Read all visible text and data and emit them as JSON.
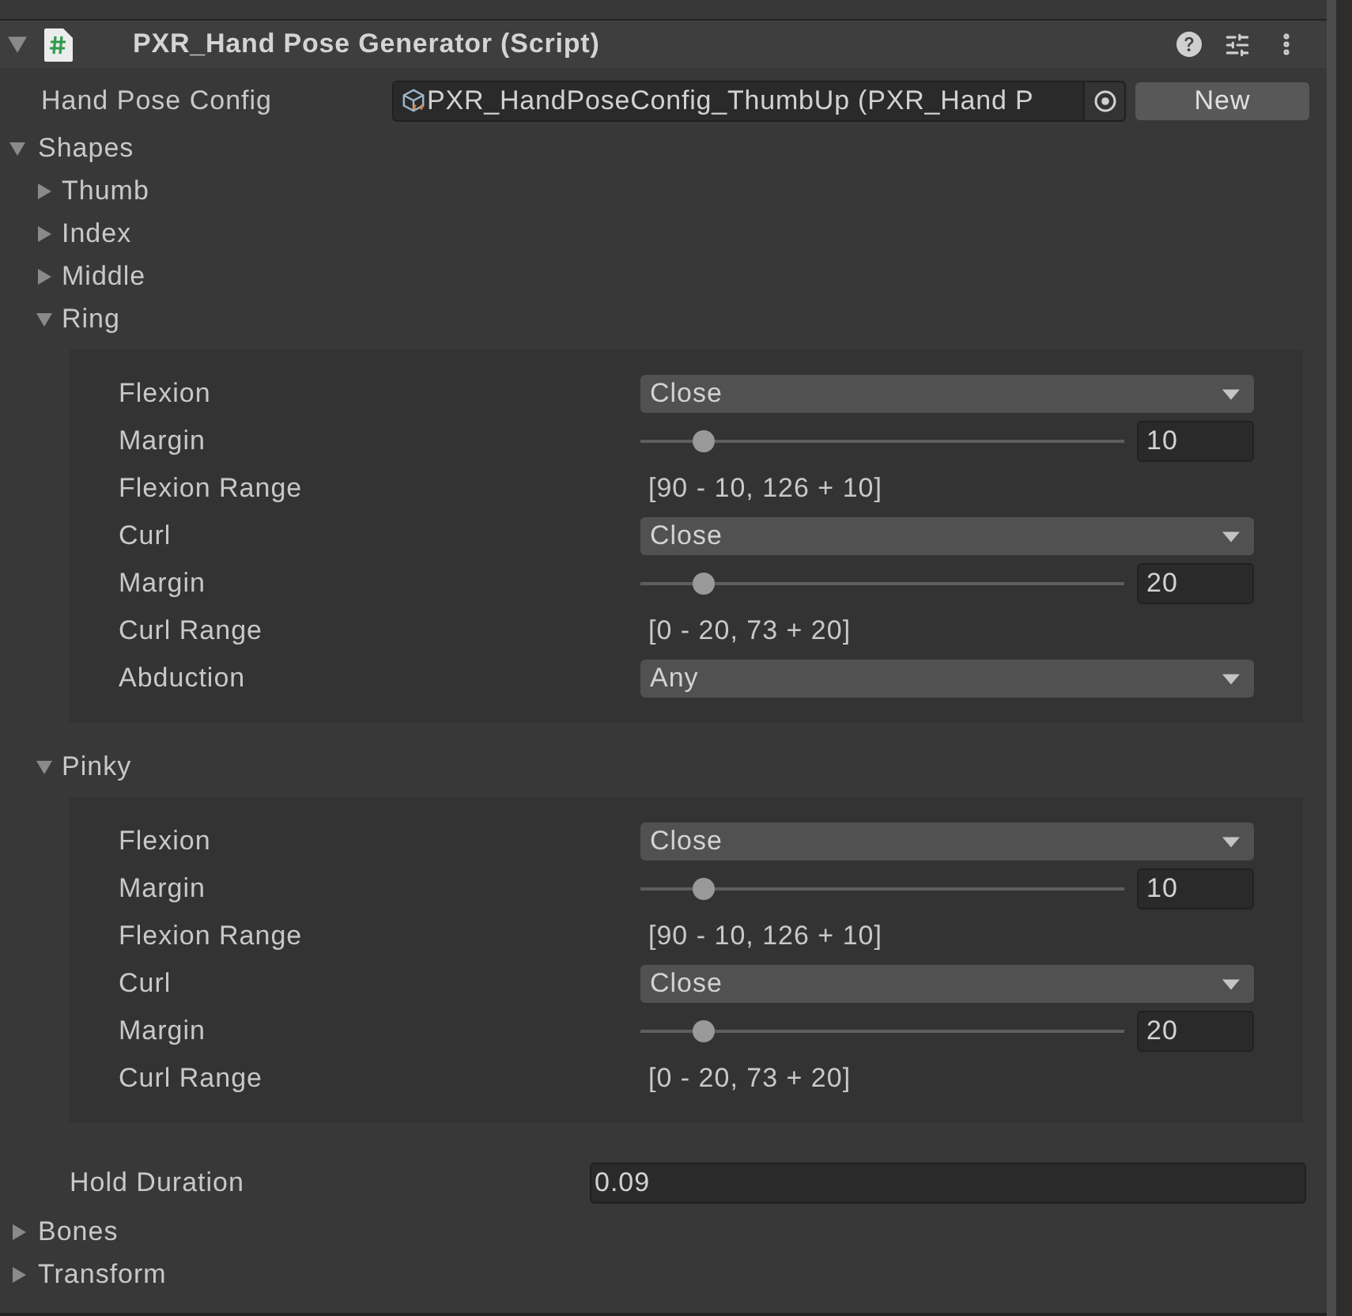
{
  "component": {
    "title": "PXR_Hand Pose Generator (Script)",
    "expanded": true
  },
  "hand_pose_config": {
    "label": "Hand Pose Config",
    "value": "PXR_HandPoseConfig_ThumbUp (PXR_Hand P",
    "button": "New"
  },
  "shapes": {
    "label": "Shapes",
    "expanded": true,
    "children": [
      {
        "label": "Thumb",
        "expanded": false
      },
      {
        "label": "Index",
        "expanded": false
      },
      {
        "label": "Middle",
        "expanded": false
      },
      {
        "label": "Ring",
        "expanded": true,
        "fields": [
          {
            "kind": "dropdown",
            "label": "Flexion",
            "value": "Close"
          },
          {
            "kind": "slider",
            "label": "Margin",
            "level": 0.13,
            "value": "10"
          },
          {
            "kind": "readout",
            "label": "Flexion Range",
            "value": "[90 - 10, 126 + 10]"
          },
          {
            "kind": "dropdown",
            "label": "Curl",
            "value": "Close"
          },
          {
            "kind": "slider",
            "label": "Margin",
            "level": 0.13,
            "value": "20"
          },
          {
            "kind": "readout",
            "label": "Curl Range",
            "value": "[0 - 20, 73 + 20]"
          },
          {
            "kind": "dropdown",
            "label": "Abduction",
            "value": "Any"
          }
        ]
      },
      {
        "label": "Pinky",
        "expanded": true,
        "fields": [
          {
            "kind": "dropdown",
            "label": "Flexion",
            "value": "Close"
          },
          {
            "kind": "slider",
            "label": "Margin",
            "level": 0.13,
            "value": "10"
          },
          {
            "kind": "readout",
            "label": "Flexion Range",
            "value": "[90 - 10, 126 + 10]"
          },
          {
            "kind": "dropdown",
            "label": "Curl",
            "value": "Close"
          },
          {
            "kind": "slider",
            "label": "Margin",
            "level": 0.13,
            "value": "20"
          },
          {
            "kind": "readout",
            "label": "Curl Range",
            "value": "[0 - 20, 73 + 20]"
          }
        ]
      }
    ]
  },
  "hold_duration": {
    "label": "Hold Duration",
    "value": "0.09"
  },
  "sections": [
    {
      "label": "Bones",
      "expanded": false
    },
    {
      "label": "Transform",
      "expanded": false
    }
  ]
}
